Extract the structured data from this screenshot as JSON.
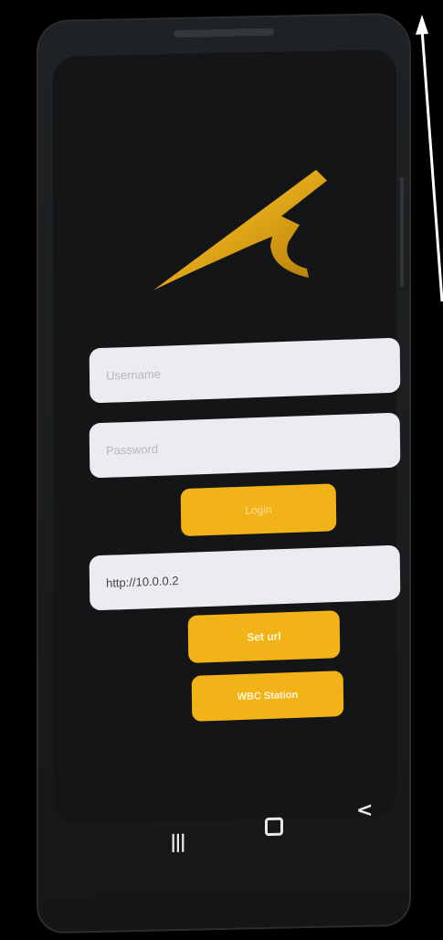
{
  "login_form": {
    "username_placeholder": "Username",
    "password_placeholder": "Password",
    "login_label": "Login"
  },
  "server": {
    "url_value": "http://10.0.0.2",
    "set_url_label": "Set url",
    "wbc_label": "WBC Station"
  },
  "nav": {
    "recents_icon": "recents-icon",
    "home_icon": "home-icon",
    "back_icon": "back-icon",
    "recents_glyph": "|||",
    "back_glyph": "<"
  },
  "colors": {
    "accent": "#f2b318",
    "logo_gold": "#e0a617",
    "field_bg": "#ececf0",
    "screen_bg": "#141516"
  }
}
